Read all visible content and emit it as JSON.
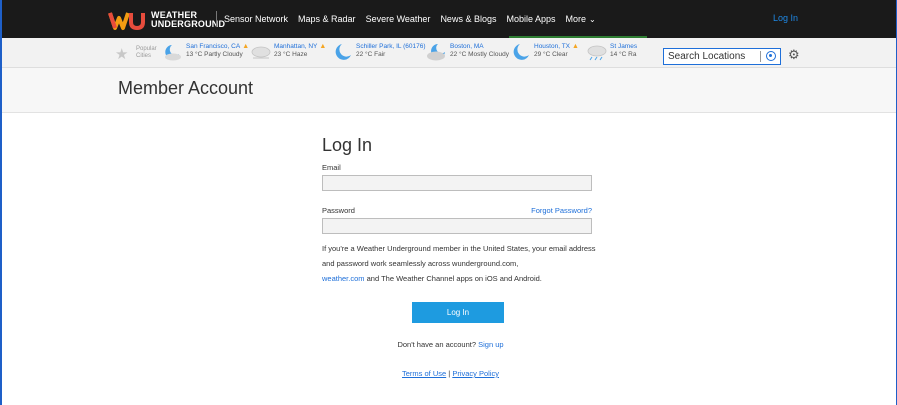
{
  "nav": {
    "logo_line1": "WEATHER",
    "logo_line2": "UNDERGROUND",
    "links": [
      "Sensor Network",
      "Maps & Radar",
      "Severe Weather",
      "News & Blogs",
      "Mobile Apps"
    ],
    "more_label": "More",
    "login_label": "Log In"
  },
  "citybar": {
    "popular_line1": "Popular",
    "popular_line2": "Cities",
    "cities": [
      {
        "name": "San Francisco, CA",
        "cond": "13 °C Partly Cloudy",
        "icon": "partly-cloudy-night-icon",
        "warning": true
      },
      {
        "name": "Manhattan, NY",
        "cond": "23 °C Haze",
        "icon": "haze-icon",
        "warning": true
      },
      {
        "name": "Schiller Park, IL (60176)",
        "cond": "22 °C Fair",
        "icon": "clear-night-icon",
        "warning": false
      },
      {
        "name": "Boston, MA",
        "cond": "22 °C Mostly Cloudy",
        "icon": "mostly-cloudy-night-icon",
        "warning": false
      },
      {
        "name": "Houston, TX",
        "cond": "29 °C Clear",
        "icon": "clear-night-icon",
        "warning": true
      },
      {
        "name": "St James",
        "cond": "14 °C Ra",
        "icon": "rain-icon",
        "warning": false
      }
    ],
    "search_placeholder": "Search Locations"
  },
  "page": {
    "title": "Member Account"
  },
  "form": {
    "title": "Log In",
    "email_label": "Email",
    "email_value": "",
    "password_label": "Password",
    "password_value": "",
    "forgot_label": "Forgot Password?",
    "info_text_1": "If you're a Weather Underground member in the United States, your email address and password work seamlessly across wunderground.com,",
    "info_link": "weather.com",
    "info_text_2": " and The Weather Channel apps on iOS and Android.",
    "login_button": "Log In",
    "no_account_text": "Don't have an account?",
    "signup_link": "Sign up",
    "terms_link": "Terms of Use",
    "separator": " | ",
    "privacy_link": "Privacy Policy"
  },
  "colors": {
    "nav_bg": "#1a1a1a",
    "accent_blue": "#1e6fd9",
    "button_blue": "#1e9be0",
    "warning": "#f5a623"
  }
}
